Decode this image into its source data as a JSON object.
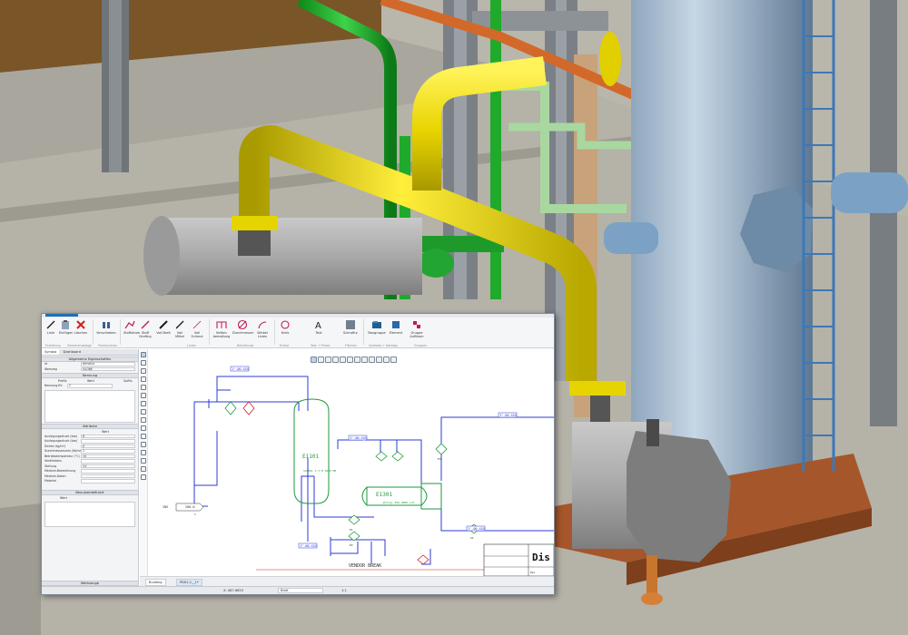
{
  "ribbon": {
    "buttons": [
      {
        "label": "Linie",
        "icon": "line-icon"
      },
      {
        "label": "Einfügen",
        "icon": "paste-icon"
      },
      {
        "label": "Löschen",
        "icon": "delete-icon"
      },
      {
        "label": "Verschieben",
        "icon": "move-icon"
      },
      {
        "label": "Stoffstrom",
        "icon": "stream-icon"
      },
      {
        "label": "Stoff Draftng",
        "icon": "draft-icon"
      },
      {
        "label": "Voll Breit",
        "icon": "full-width-icon"
      },
      {
        "label": "Voll Mittel",
        "icon": "full-mid-icon"
      },
      {
        "label": "Voll Schmal",
        "icon": "full-narrow-icon"
      },
      {
        "label": "Ketten bemaßung",
        "icon": "chain-dim-icon"
      },
      {
        "label": "Durchmesser",
        "icon": "diameter-icon"
      },
      {
        "label": "Winkel Linien",
        "icon": "angle-icon"
      },
      {
        "label": "Kreis",
        "icon": "circle-icon"
      },
      {
        "label": "Text",
        "icon": "text-icon"
      },
      {
        "label": "Schraffur",
        "icon": "hatch-icon"
      },
      {
        "label": "Baugruppe",
        "icon": "assembly-icon"
      },
      {
        "label": "Element",
        "icon": "element-icon"
      },
      {
        "label": "Gruppe Auflösen",
        "icon": "ungroup-icon"
      }
    ],
    "groups": [
      "Erstellung",
      "Zwischenablage",
      "Positionieren",
      "Linien",
      "Bemaßung",
      "Kreise",
      "Text + Preise",
      "Flächen",
      "Symbole + Katalog",
      "Gruppen"
    ]
  },
  "left_panel": {
    "tabs": [
      "Symbol",
      "Dashboard"
    ],
    "general_header": "Allgemeine Eigenschaften",
    "general_rows": [
      {
        "label": "ld",
        "value": "Armatur"
      },
      {
        "label": "Werkzeg",
        "value": "GLOBE"
      }
    ],
    "naming_header": "Nennung",
    "naming_columns": [
      "Prefix",
      "Wert",
      "Suffix"
    ],
    "naming_row": {
      "label": "Nennung",
      "prefix": "HV",
      "value": "2"
    },
    "attributes_header": "Attribute",
    "attributes_col": "Wert",
    "attribute_rows": [
      {
        "label": "Auslegungsdruck (bar)",
        "value": "8"
      },
      {
        "label": "Auslegungsdruck (bar)",
        "value": ""
      },
      {
        "label": "Dichte (kg/m³)",
        "value": "0"
      },
      {
        "label": "Durchmessersmm (W/mm.)",
        "value": "1"
      },
      {
        "label": "Betriebstemperatur (°C)",
        "value": "10"
      },
      {
        "label": "Ventilstatus",
        "value": ""
      },
      {
        "label": "Stellung",
        "value": "CV"
      },
      {
        "label": "Medium-Bezeichnung",
        "value": ""
      },
      {
        "label": "Medium-Daten",
        "value": ""
      },
      {
        "label": "Material",
        "value": ""
      }
    ],
    "notes_header": "Benutzerdefiniert",
    "notes_label": "Wert",
    "tools_header": "Werkzeuge"
  },
  "diagram": {
    "equipment": [
      {
        "tag": "E1101",
        "spec": "SCHEDL S.T.M\n1000 MM"
      },
      {
        "tag": "E1301",
        "spec": "Ø(Arg) 504\n4800 L/P"
      }
    ],
    "line_labels": [
      "1\"-00-XXX",
      "1\"-00-XXX",
      "1\"-00-XXX",
      "1\"-00-XXX",
      "1\"-00-XXX"
    ],
    "inlet": {
      "tag": "INS",
      "label": "200.0",
      "sub": "1"
    },
    "valves": [
      "E1",
      "E2",
      "E3",
      "V1"
    ],
    "vendor_break": "VENDOR BREAK",
    "title_block": {
      "title": "Dis",
      "rev": "Rev"
    }
  },
  "doc_tabs": [
    "Building",
    "PD01-1__1*"
  ],
  "status": {
    "coords": "X: 487.6853",
    "layer": "Blatt",
    "scale": "1:1"
  },
  "colors": {
    "pipe_blue": "#2b3bd6",
    "equipment_green": "#1e9a3a",
    "accent": "#1f6fb5"
  }
}
